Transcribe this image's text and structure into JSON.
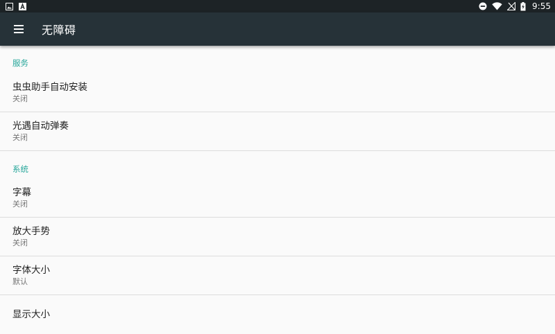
{
  "status_bar": {
    "left_icons": [
      "image-icon",
      "a-letter-icon"
    ],
    "right_icons": [
      "do-not-disturb-icon",
      "wifi-icon",
      "no-signal-icon",
      "battery-charging-icon"
    ],
    "time": "9:55"
  },
  "toolbar": {
    "menu_icon": "hamburger-menu-icon",
    "title": "无障碍"
  },
  "sections": [
    {
      "header": "服务",
      "items": [
        {
          "title": "虫虫助手自动安装",
          "summary": "关闭"
        },
        {
          "title": "光遇自动弹奏",
          "summary": "关闭"
        }
      ]
    },
    {
      "header": "系统",
      "items": [
        {
          "title": "字幕",
          "summary": "关闭"
        },
        {
          "title": "放大手势",
          "summary": "关闭"
        },
        {
          "title": "字体大小",
          "summary": "默认"
        },
        {
          "title": "显示大小",
          "summary": ""
        }
      ]
    }
  ],
  "colors": {
    "status_bar_bg": "#1d2326",
    "toolbar_bg": "#263238",
    "accent": "#26a69a",
    "background": "#fafafa"
  }
}
